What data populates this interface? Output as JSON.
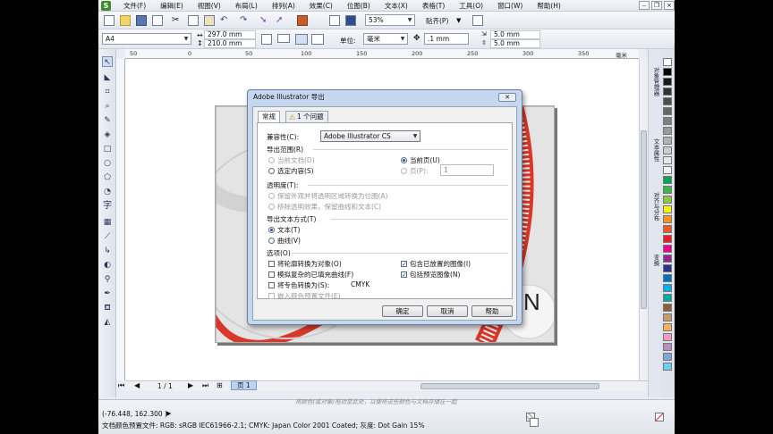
{
  "menu": [
    "文件(F)",
    "编辑(E)",
    "视图(V)",
    "布局(L)",
    "排列(A)",
    "效果(C)",
    "位图(B)",
    "文本(X)",
    "表格(T)",
    "工具(O)",
    "窗口(W)",
    "帮助(H)"
  ],
  "toolbar": {
    "zoom": "53%",
    "snap": "贴齐(P)",
    "paper_size": "A4",
    "width": "297.0 mm",
    "height": "210.0 mm",
    "units_label": "单位:",
    "units": "毫米",
    "nudge": ".1 mm",
    "dup_x": "5.0 mm",
    "dup_y": "5.0 mm"
  },
  "rulers": {
    "top": [
      "50",
      "0",
      "50",
      "100",
      "150",
      "200",
      "250",
      "300",
      "350"
    ],
    "unit": "毫米"
  },
  "dialog": {
    "title": "Adobe Illustrator 导出",
    "close": "✕",
    "tabs": [
      "常规",
      "1 个问题"
    ],
    "compat_label": "兼容性(C):",
    "compat_value": "Adobe Illustrator CS",
    "export_range": {
      "label": "导出范围(R)",
      "current_doc": "当前文档(D)",
      "selected": "选定内容(S)",
      "current_page": "当前页(U)",
      "pages": "页(P):",
      "pages_value": "1"
    },
    "transparency": {
      "label": "透明度(T):",
      "opt1": "保留外观并将透明区域转换为位图(A)",
      "opt2": "移除透明效果，保留曲线和文本(C)"
    },
    "text_export": {
      "label": "导出文本方式(T)",
      "as_text": "文本(T)",
      "as_curves": "曲线(V)"
    },
    "options": {
      "label": "选项(O)",
      "convert_outlines": "将轮廓转换为对象(O)",
      "simulate_fills": "模拟复杂的已填充曲线(F)",
      "spot_convert": "将专色转换为(S):",
      "spot_value": "CMYK",
      "embed_profile": "嵌入颜色预置文件(E)",
      "include_placed": "包含已放置的图像(I)",
      "include_preview": "包括预览图像(N)"
    },
    "buttons": {
      "ok": "确定",
      "cancel": "取消",
      "help": "帮助"
    }
  },
  "canvas_letter": "N",
  "pagenav": {
    "counter": "1 / 1",
    "page_tab": "页 1"
  },
  "hint": "将颜色(或对象)拖动至此处，以便将这些颜色与文档存储在一起",
  "status": {
    "coords": "(-76.448, 162.300 )",
    "color_profile": "文档颜色预置文件: RGB: sRGB IEC61966-2.1; CMYK: Japan Color 2001 Coated; 灰度: Dot Gain 15%"
  },
  "dockers": [
    "对象管理器",
    "文本属性",
    "对齐与分布",
    "变换"
  ],
  "palette": [
    "#ffffff",
    "#000000",
    "#1a1a1a",
    "#333333",
    "#4d4d4d",
    "#666666",
    "#808080",
    "#999999",
    "#b3b3b3",
    "#cccccc",
    "#e6e6e6",
    "#f2f2f2",
    "#00a651",
    "#39b54a",
    "#8dc63f",
    "#fff200",
    "#f7941d",
    "#f15a24",
    "#ed1c24",
    "#ec008c",
    "#92278f",
    "#2e3192",
    "#0072bc",
    "#00aeef",
    "#00a99d",
    "#8c6239",
    "#c69c6d",
    "#fbaf5d",
    "#f49ac1",
    "#bd8cbf",
    "#7da7d9",
    "#6dcff6"
  ],
  "colors": {
    "accent": "#1d4f9c",
    "red_shape": "#d93829"
  }
}
